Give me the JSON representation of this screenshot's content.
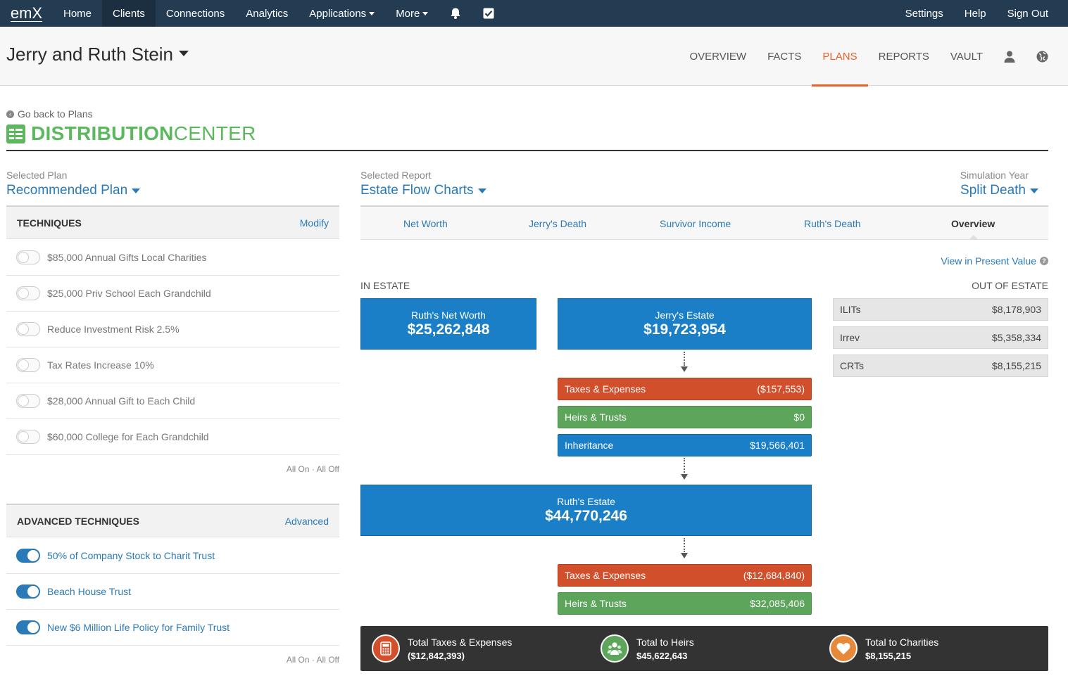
{
  "app": {
    "logo": "emX",
    "nav": [
      {
        "label": "Home"
      },
      {
        "label": "Clients"
      },
      {
        "label": "Connections"
      },
      {
        "label": "Analytics"
      },
      {
        "label": "Applications"
      },
      {
        "label": "More"
      }
    ],
    "nav_right": [
      {
        "label": "Settings"
      },
      {
        "label": "Help"
      },
      {
        "label": "Sign Out"
      }
    ],
    "icons": {
      "bell": "bell-icon",
      "tasks": "checkbox-icon",
      "person": "person-icon",
      "globe": "globe-icon"
    }
  },
  "client": {
    "name": "Jerry and Ruth Stein",
    "tabs": [
      {
        "label": "OVERVIEW"
      },
      {
        "label": "FACTS"
      },
      {
        "label": "PLANS"
      },
      {
        "label": "REPORTS"
      },
      {
        "label": "VAULT"
      }
    ],
    "active_tab": "PLANS"
  },
  "page": {
    "back_link": "Go back to Plans",
    "title_bold": "DISTRIBUTION",
    "title_thin": "CENTER"
  },
  "selectors": {
    "plan": {
      "label": "Selected Plan",
      "value": "Recommended Plan"
    },
    "report": {
      "label": "Selected Report",
      "value": "Estate Flow Charts"
    },
    "year": {
      "label": "Simulation Year",
      "value": "Split Death"
    }
  },
  "techniques": {
    "title": "TECHNIQUES",
    "link": "Modify",
    "items": [
      {
        "label": "$85,000 Annual Gifts Local Charities",
        "on": false
      },
      {
        "label": "$25,000 Priv School Each Grandchild",
        "on": false
      },
      {
        "label": "Reduce Investment Risk 2.5%",
        "on": false
      },
      {
        "label": "Tax Rates Increase 10%",
        "on": false
      },
      {
        "label": "$28,000 Annual Gift to Each Child",
        "on": false
      },
      {
        "label": "$60,000 College for Each Grandchild",
        "on": false
      }
    ],
    "all_on_off": "All On · All Off"
  },
  "advanced": {
    "title": "ADVANCED TECHNIQUES",
    "link": "Advanced",
    "items": [
      {
        "label": "50% of Company Stock to Charit Trust",
        "on": true
      },
      {
        "label": "Beach House Trust",
        "on": true
      },
      {
        "label": "New $6 Million Life Policy for Family Trust",
        "on": true
      }
    ],
    "all_on_off": "All On · All Off"
  },
  "report_tabs": [
    {
      "label": "Net Worth"
    },
    {
      "label": "Jerry's Death"
    },
    {
      "label": "Survivor Income"
    },
    {
      "label": "Ruth's Death"
    },
    {
      "label": "Overview"
    }
  ],
  "active_report_tab": "Overview",
  "present_value_link": "View in Present Value",
  "flow": {
    "in_estate_label": "IN ESTATE",
    "out_estate_label": "OUT OF ESTATE",
    "ruth_net_worth": {
      "label": "Ruth's Net Worth",
      "value": "$25,262,848"
    },
    "jerry_estate": {
      "label": "Jerry's Estate",
      "value": "$19,723,954"
    },
    "jerry_bars": [
      {
        "label": "Taxes & Expenses",
        "value": "($157,553)",
        "color": "#d24f2b"
      },
      {
        "label": "Heirs & Trusts",
        "value": "$0",
        "color": "#5ca55a"
      },
      {
        "label": "Inheritance",
        "value": "$19,566,401",
        "color": "#1a7fc6"
      }
    ],
    "ruth_estate": {
      "label": "Ruth's Estate",
      "value": "$44,770,246"
    },
    "ruth_bars": [
      {
        "label": "Taxes & Expenses",
        "value": "($12,684,840)",
        "color": "#d24f2b"
      },
      {
        "label": "Heirs & Trusts",
        "value": "$32,085,406",
        "color": "#5ca55a"
      }
    ],
    "out_of_estate": [
      {
        "label": "ILITs",
        "value": "$8,178,903"
      },
      {
        "label": "Irrev",
        "value": "$5,358,334"
      },
      {
        "label": "CRTs",
        "value": "$8,155,215"
      }
    ]
  },
  "totals": [
    {
      "label": "Total Taxes & Expenses",
      "value": "($12,842,393)",
      "icon": "calculator-icon",
      "color": "#d24f2b"
    },
    {
      "label": "Total to Heirs",
      "value": "$45,622,643",
      "icon": "people-icon",
      "color": "#5ca55a"
    },
    {
      "label": "Total to Charities",
      "value": "$8,155,215",
      "icon": "heart-icon",
      "color": "#e8893a"
    }
  ]
}
